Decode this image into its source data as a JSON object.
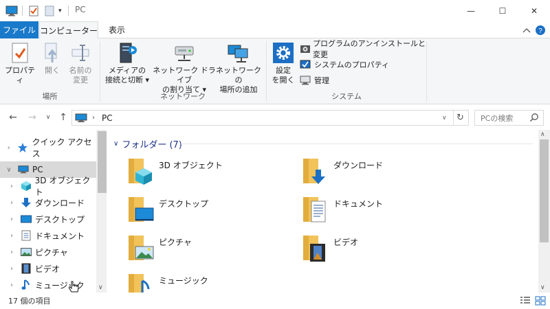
{
  "window": {
    "title": "PC",
    "controls": {
      "minimize": "—",
      "maximize": "☐",
      "close": "✕"
    }
  },
  "ribbon_tabs": {
    "file": "ファイル",
    "computer": "コンピューター",
    "view": "表示"
  },
  "ribbon": {
    "location_group": {
      "label": "場所",
      "properties": [
        "プロパティ"
      ],
      "open": [
        "開く"
      ],
      "rename": [
        "名前の",
        "変更"
      ]
    },
    "network_group": {
      "label": "ネットワーク",
      "media": [
        "メディアの",
        "接続と切断 ▾"
      ],
      "map_drive": [
        "ネットワーク ドライブ",
        "の割り当て ▾"
      ],
      "add_location": [
        "ネットワークの",
        "場所の追加"
      ]
    },
    "system_group": {
      "label": "システム",
      "open_settings": [
        "設定",
        "を開く"
      ],
      "uninstall": "プログラムのアンインストールと変更",
      "system_props": "システムのプロパティ",
      "manage": "管理"
    }
  },
  "address": {
    "path": "PC",
    "search_placeholder": "PCの検索"
  },
  "nav_tree": [
    {
      "label": "クイック アクセス",
      "icon": "star-icon"
    },
    {
      "label": "PC",
      "icon": "computer-icon",
      "selected": true,
      "expanded": true
    },
    {
      "label": "3D オブジェクト",
      "icon": "cube-icon"
    },
    {
      "label": "ダウンロード",
      "icon": "download-icon"
    },
    {
      "label": "デスクトップ",
      "icon": "desktop-icon"
    },
    {
      "label": "ドキュメント",
      "icon": "document-icon"
    },
    {
      "label": "ピクチャ",
      "icon": "picture-icon"
    },
    {
      "label": "ビデオ",
      "icon": "video-icon"
    },
    {
      "label": "ミュージック",
      "icon": "music-icon"
    }
  ],
  "content": {
    "group_title": "フォルダー (7)",
    "folders": [
      {
        "name": "3D オブジェクト",
        "icon": "cube-folder-icon"
      },
      {
        "name": "ダウンロード",
        "icon": "download-folder-icon"
      },
      {
        "name": "デスクトップ",
        "icon": "desktop-folder-icon"
      },
      {
        "name": "ドキュメント",
        "icon": "document-folder-icon"
      },
      {
        "name": "ピクチャ",
        "icon": "picture-folder-icon"
      },
      {
        "name": "ビデオ",
        "icon": "video-folder-icon"
      },
      {
        "name": "ミュージック",
        "icon": "music-folder-icon"
      }
    ]
  },
  "status": {
    "item_count": "17 個の項目"
  },
  "colors": {
    "file_tab": "#1979ca",
    "selected": "#d9d9d9",
    "folder": "#f1c35a",
    "group_header": "#1e3287"
  }
}
